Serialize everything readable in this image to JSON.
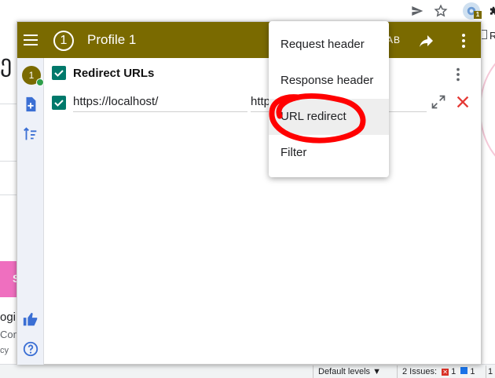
{
  "browser": {
    "toolbar_icons": [
      "send-icon",
      "star-icon",
      "extension-icon",
      "puzzle-icon"
    ],
    "extension_badge": "1",
    "background_text": {
      "left_glyph": "ე",
      "left_login": "ogin",
      "left_com": "Com",
      "left_cy": "cy",
      "left_s": "S",
      "right_r": "R"
    }
  },
  "devtools": {
    "levels_label": "Default levels ▼",
    "issues_label": "2 Issues:",
    "error_count": "1",
    "info_count": "1",
    "warn_count": "1"
  },
  "header": {
    "profile_number": "1",
    "title": "Profile 1",
    "ab_label": "AB",
    "color": "#7a6a00"
  },
  "sidebar": {
    "avatar_number": "1"
  },
  "group": {
    "title": "Redirect URLs",
    "enabled": true,
    "rule": {
      "enabled": true,
      "from_value": "https://localhost/",
      "to_value": "http"
    }
  },
  "menu": {
    "items": [
      {
        "label": "Request header"
      },
      {
        "label": "Response header"
      },
      {
        "label": "URL redirect"
      },
      {
        "label": "Filter"
      }
    ]
  },
  "colors": {
    "accent": "#7a6a00",
    "checkbox": "#00796b",
    "delete": "#e53935",
    "sidebar_icon": "#3b6fd4",
    "highlight": "#ff0000"
  }
}
